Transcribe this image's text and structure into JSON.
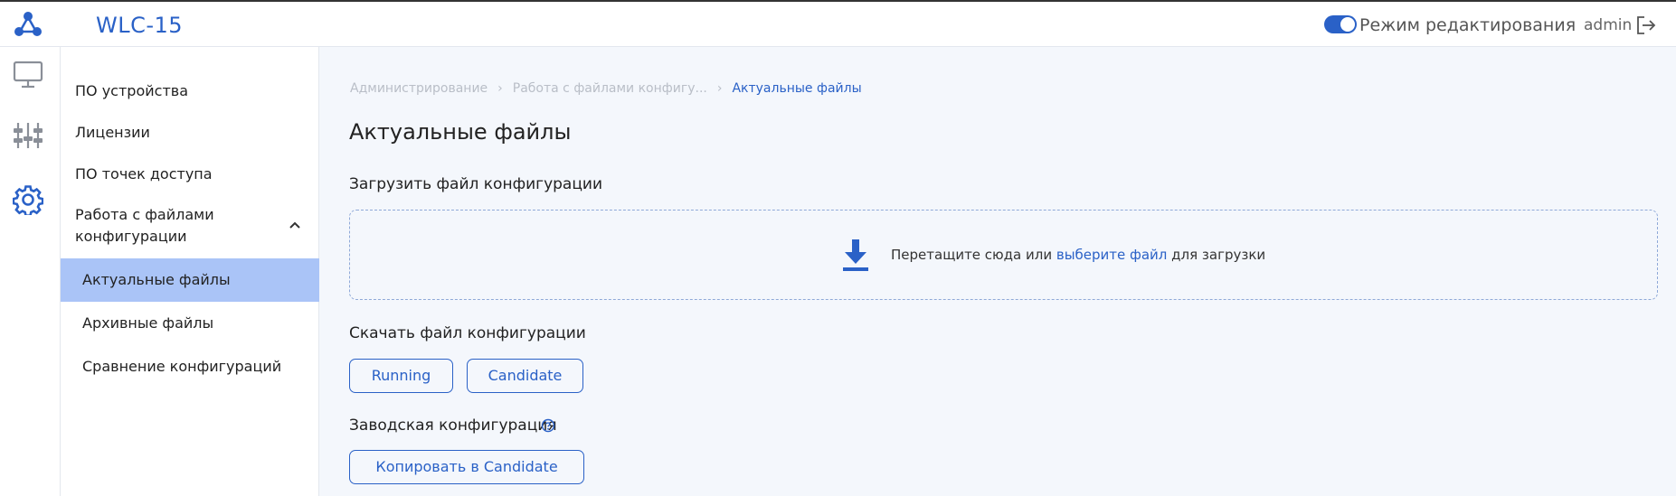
{
  "header": {
    "app_title": "WLC-15",
    "edit_mode_label": "Режим редактирования",
    "edit_mode_on": true,
    "user": "admin",
    "logo_icon": "network-logo-icon",
    "logout_icon": "logout-icon"
  },
  "rail": {
    "items": [
      {
        "icon": "monitor-icon",
        "active": false
      },
      {
        "icon": "sliders-icon",
        "active": false
      },
      {
        "icon": "gear-icon",
        "active": true
      }
    ]
  },
  "sidebar": {
    "items": [
      {
        "label": "ПО устройства"
      },
      {
        "label": "Лицензии"
      },
      {
        "label": "ПО точек доступа"
      },
      {
        "label": "Работа с файлами конфигурации",
        "expanded": true
      },
      {
        "label": "Актуальные файлы",
        "active": true
      },
      {
        "label": "Архивные файлы"
      },
      {
        "label": "Сравнение конфигураций"
      }
    ]
  },
  "breadcrumb": {
    "items": [
      "Администрирование",
      "Работа с файлами конфигу...",
      "Актуальные файлы"
    ]
  },
  "main": {
    "title": "Актуальные файлы",
    "upload_title": "Загрузить файл конфигурации",
    "drop_text_before": "Перетащите сюда или ",
    "drop_link": "выберите файл",
    "drop_text_after": " для загрузки",
    "download_title": "Скачать файл конфигурации",
    "running_button": "Running",
    "candidate_button": "Candidate",
    "factory_title": "Заводская конфигурация",
    "copy_button": "Копировать в Candidate"
  },
  "colors": {
    "accent": "#2a61c7",
    "active_item_bg": "#aac4f7",
    "page_bg": "#f4f7fc"
  }
}
